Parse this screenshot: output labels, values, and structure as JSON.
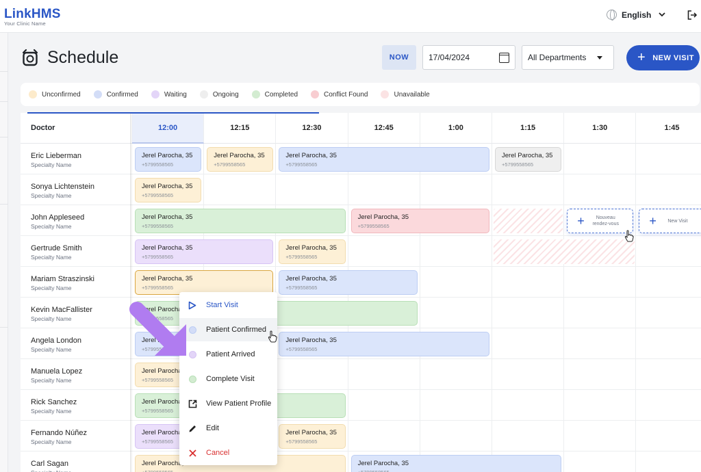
{
  "app": {
    "brand": "Link",
    "brand_suffix": "HMS",
    "clinic_name": "Your Clinic Name",
    "language": "English"
  },
  "page": {
    "title": "Schedule"
  },
  "toolbar": {
    "now_label": "NOW",
    "date_value": "17/04/2024",
    "department": "All Departments",
    "new_visit_label": "NEW VISIT"
  },
  "legend": [
    {
      "label": "Unconfirmed",
      "color": "#fdebcb"
    },
    {
      "label": "Confirmed",
      "color": "#d3ddf7"
    },
    {
      "label": "Waiting",
      "color": "#e3d5f8"
    },
    {
      "label": "Ongoing",
      "color": "#eeeeee"
    },
    {
      "label": "Completed",
      "color": "#d3ecd1"
    },
    {
      "label": "Conflict Found",
      "color": "#f8cdd1"
    },
    {
      "label": "Unavailable",
      "color": "#fbe3e4"
    }
  ],
  "grid": {
    "doctor_header": "Doctor",
    "times": [
      "12:00",
      "12:15",
      "12:30",
      "12:45",
      "1:00",
      "1:15",
      "1:30",
      "1:45"
    ],
    "active_time": "12:00",
    "doctors": [
      {
        "name": "Eric Lieberman",
        "specialty": "Specialty Name"
      },
      {
        "name": "Sonya Lichtenstein",
        "specialty": "Specialty Name"
      },
      {
        "name": "John Appleseed",
        "specialty": "Specialty Name"
      },
      {
        "name": "Gertrude Smith",
        "specialty": "Specialty Name"
      },
      {
        "name": "Mariam Straszinski",
        "specialty": "Specialty Name"
      },
      {
        "name": "Kevin MacFallister",
        "specialty": "Specialty Name"
      },
      {
        "name": "Angela London",
        "specialty": "Specialty Name"
      },
      {
        "name": "Manuela Lopez",
        "specialty": "Specialty Name"
      },
      {
        "name": "Rick Sanchez",
        "specialty": "Specialty Name"
      },
      {
        "name": "Fernando Núñez",
        "specialty": "Specialty Name"
      },
      {
        "name": "Carl Sagan",
        "specialty": "Specialty Name"
      }
    ],
    "appointment_name": "Jerel Parocha, 35",
    "appointment_phone": "+5799558565",
    "new_slot_fr": "Nouveau rendez-vous",
    "new_slot_en": "New Visit"
  },
  "context_menu": [
    {
      "label": "Start Visit",
      "icon": "play-icon"
    },
    {
      "label": "Patient Confirmed",
      "icon": "confirmed-dot-icon"
    },
    {
      "label": "Patient Arrived",
      "icon": "waiting-dot-icon"
    },
    {
      "label": "Complete Visit",
      "icon": "completed-dot-icon"
    },
    {
      "label": "View Patient Profile",
      "icon": "external-link-icon"
    },
    {
      "label": "Edit",
      "icon": "pencil-icon"
    },
    {
      "label": "Cancel",
      "icon": "close-icon"
    }
  ]
}
